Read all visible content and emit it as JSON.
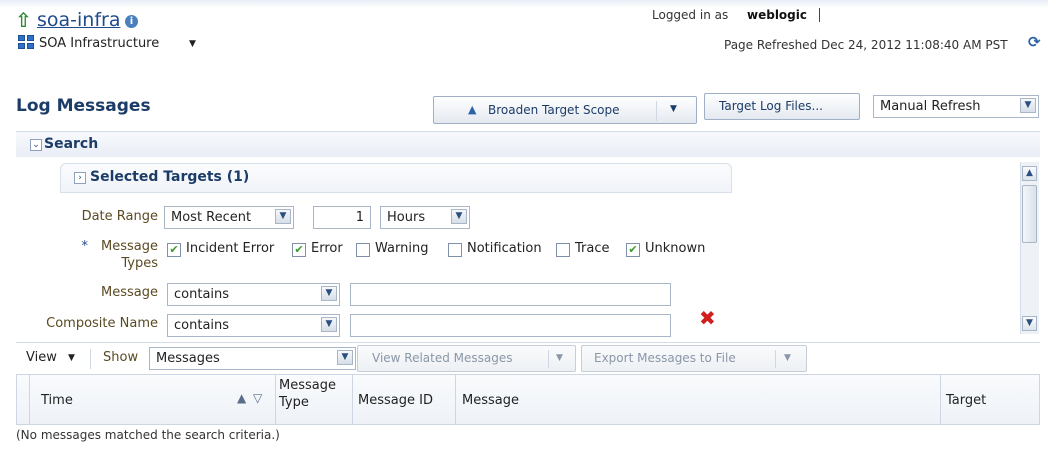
{
  "header": {
    "app_name": "soa-infra",
    "menu_label": "SOA Infrastructure",
    "logged_in_prefix": "Logged in as",
    "user": "weblogic",
    "refresh_status": "Page Refreshed Dec 24, 2012 11:08:40 AM PST"
  },
  "page": {
    "title": "Log Messages",
    "broaden_button": "Broaden Target Scope",
    "target_log_files_button": "Target Log Files...",
    "refresh_mode": "Manual Refresh"
  },
  "search": {
    "section_label": "Search",
    "selected_targets": "Selected Targets (1)",
    "date_range_label": "Date Range",
    "date_range_value": "Most Recent",
    "count_value": "1",
    "unit_value": "Hours",
    "required_marker": "*",
    "message_types_label_1": "Message",
    "message_types_label_2": "Types",
    "types": [
      {
        "label": "Incident Error",
        "checked": true
      },
      {
        "label": "Error",
        "checked": true
      },
      {
        "label": "Warning",
        "checked": false
      },
      {
        "label": "Notification",
        "checked": false
      },
      {
        "label": "Trace",
        "checked": false
      },
      {
        "label": "Unknown",
        "checked": true
      }
    ],
    "message_label": "Message",
    "message_op": "contains",
    "message_value": "",
    "composite_label": "Composite Name",
    "composite_op": "contains",
    "composite_value": ""
  },
  "toolbar": {
    "view_label": "View",
    "show_label": "Show",
    "show_value": "Messages",
    "view_related": "View Related Messages",
    "export": "Export Messages to File"
  },
  "table": {
    "col_time": "Time",
    "col_type_1": "Message",
    "col_type_2": "Type",
    "col_id": "Message ID",
    "col_message": "Message",
    "col_target": "Target",
    "empty_text": "(No messages matched the search criteria.)"
  },
  "colors": {
    "accent": "#1f4a8c",
    "home_icon": "#2e8b3a",
    "delete_icon": "#d11f1f"
  }
}
